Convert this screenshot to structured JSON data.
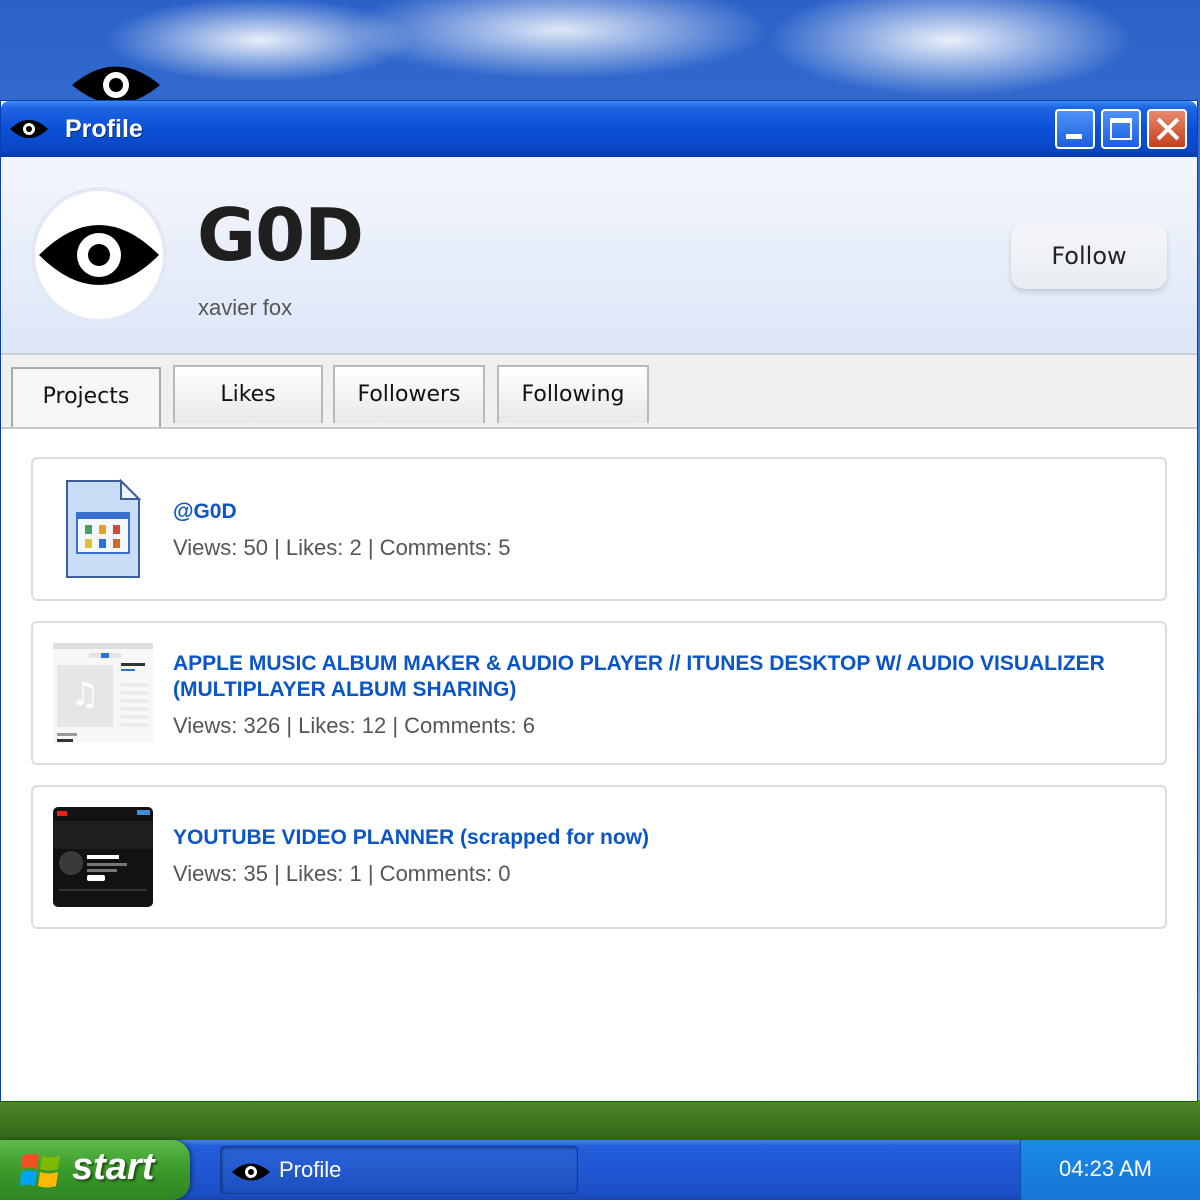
{
  "window": {
    "title": "Profile",
    "controls": {
      "minimize": "minimize",
      "maximize": "maximize",
      "close": "close"
    }
  },
  "profile": {
    "username": "G0D",
    "real_name": "xavier fox",
    "follow_label": "Follow"
  },
  "tabs": [
    {
      "label": "Projects",
      "active": true
    },
    {
      "label": "Likes",
      "active": false
    },
    {
      "label": "Followers",
      "active": false
    },
    {
      "label": "Following",
      "active": false
    }
  ],
  "projects": [
    {
      "title": "@G0D",
      "stats": "Views: 50 | Likes: 2 | Comments: 5",
      "thumbnail": "document-icon"
    },
    {
      "title": "APPLE MUSIC ALBUM MAKER & AUDIO PLAYER // ITUNES DESKTOP W/ AUDIO VISUALIZER (MULTIPLAYER ALBUM SHARING)",
      "stats": "Views: 326 | Likes: 12 | Comments: 6",
      "thumbnail": "album-maker-screenshot"
    },
    {
      "title": "YOUTUBE VIDEO PLANNER (scrapped for now)",
      "stats": "Views: 35 | Likes: 1 | Comments: 0",
      "thumbnail": "youtube-planner-screenshot"
    }
  ],
  "taskbar": {
    "start_label": "start",
    "task_label": "Profile",
    "clock": "04:23 AM"
  },
  "colors": {
    "titlebar": "#0a50d8",
    "link": "#0a55c8",
    "start_green": "#3a9a2a"
  },
  "icons": [
    "eye-icon",
    "windows-logo-icon",
    "document-icon"
  ]
}
